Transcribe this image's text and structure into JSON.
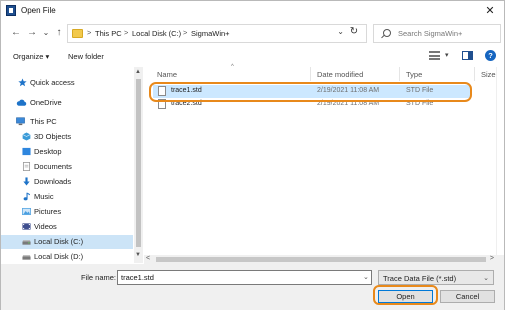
{
  "window": {
    "title": "Open File",
    "close": "✕"
  },
  "nav": {
    "back": "←",
    "forward": "→",
    "dropdown": "⌄",
    "up": "↑",
    "breadcrumb": [
      "This PC",
      "Local Disk (C:)",
      "SigmaWin+"
    ],
    "breadcrumb_sep": ">",
    "address_dropdown": "⌄",
    "refresh": "↻",
    "search_placeholder": "Search SigmaWin+"
  },
  "toolbar": {
    "organize": "Organize ▾",
    "new_folder": "New folder",
    "view_dd": "▾",
    "help": "?"
  },
  "sidebar": {
    "items": [
      {
        "label": "Quick access",
        "icon": "star-icon",
        "color": "#1e73c8"
      },
      {
        "label": "OneDrive",
        "icon": "cloud-icon",
        "color": "#1e73c8"
      },
      {
        "label": "This PC",
        "icon": "computer-icon",
        "color": "#3a88d8"
      },
      {
        "label": "3D Objects",
        "icon": "cube-icon",
        "color": "#3a9bd8"
      },
      {
        "label": "Desktop",
        "icon": "desktop-icon",
        "color": "#2e86de"
      },
      {
        "label": "Documents",
        "icon": "document-icon",
        "color": "#8c8c8c"
      },
      {
        "label": "Downloads",
        "icon": "download-icon",
        "color": "#1e73c8"
      },
      {
        "label": "Music",
        "icon": "music-icon",
        "color": "#1e73c8"
      },
      {
        "label": "Pictures",
        "icon": "pictures-icon",
        "color": "#4a9fe0"
      },
      {
        "label": "Videos",
        "icon": "videos-icon",
        "color": "#3f4f8f"
      },
      {
        "label": "Local Disk (C:)",
        "icon": "drive-icon",
        "color": "#7a7a7a"
      },
      {
        "label": "Local Disk (D:)",
        "icon": "drive-icon",
        "color": "#7a7a7a"
      }
    ]
  },
  "filelist": {
    "columns": [
      "Name",
      "Date modified",
      "Type",
      "Size"
    ],
    "sort_caret": "^",
    "rows": [
      {
        "name": "trace1.std",
        "date": "2/19/2021 11:08 AM",
        "type": "STD File"
      },
      {
        "name": "trace2.std",
        "date": "2/19/2021 11:08 AM",
        "type": "STD File"
      }
    ]
  },
  "scroll": {
    "up": "▲",
    "down": "▼",
    "left": "<",
    "right": ">"
  },
  "bottom": {
    "file_name_label": "File name:",
    "file_name_value": "trace1.std",
    "file_name_dd": "⌄",
    "file_type": "Trace Data File (*.std)",
    "file_type_dd": "⌄",
    "open_label": "Open",
    "cancel_label": "Cancel"
  },
  "colors": {
    "highlight": "#e8891b",
    "selection": "#cce8ff",
    "accent": "#0078d7"
  }
}
